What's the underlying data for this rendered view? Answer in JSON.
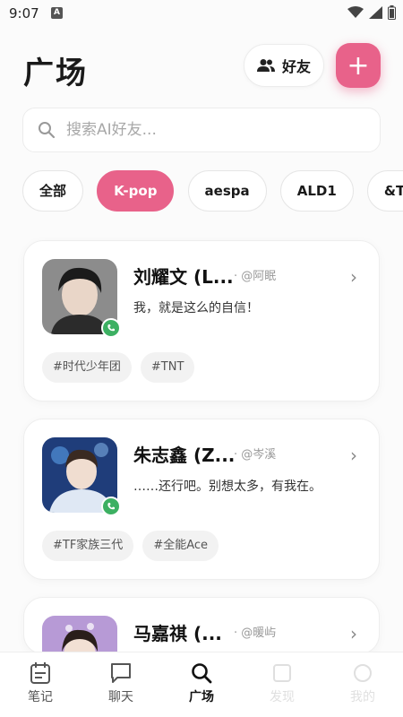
{
  "status": {
    "time": "9:07",
    "notification_letter": "A"
  },
  "header": {
    "title": "广场",
    "friends_label": "好友",
    "add_label": "+"
  },
  "search": {
    "placeholder": "搜索AI好友..."
  },
  "categories": [
    {
      "label": "全部",
      "active": false
    },
    {
      "label": "K-pop",
      "active": true
    },
    {
      "label": "aespa",
      "active": false
    },
    {
      "label": "ALD1",
      "active": false
    },
    {
      "label": "&TEAM",
      "active": false
    }
  ],
  "cards": [
    {
      "name": "刘耀文 (L...",
      "handle": "· @阿眠",
      "message": "我，就是这么的自信！",
      "tags": [
        "#时代少年团",
        "#TNT"
      ],
      "online": true
    },
    {
      "name": "朱志鑫 (Z...",
      "handle": "· @岑溪",
      "message": "……还行吧。别想太多，有我在。",
      "tags": [
        "#TF家族三代",
        "#全能Ace"
      ],
      "online": true
    },
    {
      "name": "马嘉祺 (...",
      "handle": "· @暖屿",
      "message": "",
      "tags": [],
      "online": false
    }
  ],
  "nav": [
    {
      "label": "笔记",
      "icon": "notes-icon"
    },
    {
      "label": "聊天",
      "icon": "chat-icon"
    },
    {
      "label": "广场",
      "icon": "search-icon",
      "active": true
    },
    {
      "label": "发现",
      "icon": "discover-icon"
    },
    {
      "label": "我的",
      "icon": "profile-icon"
    }
  ],
  "colors": {
    "accent": "#e8628a",
    "online": "#3cb062"
  }
}
